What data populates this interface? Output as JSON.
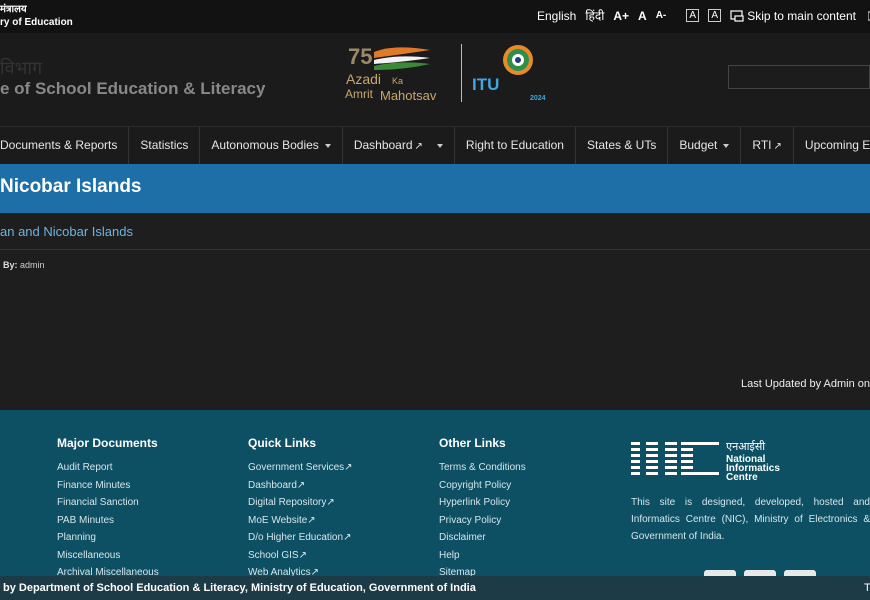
{
  "topbar": {
    "ministry_line1": "मंत्रालय",
    "ministry_line2": "ry of Education",
    "lang_english": "English",
    "lang_hindi": "हिंदी",
    "font_plus": "A+",
    "font_normal": "A",
    "font_minus": "A-",
    "contrast_a1": "A",
    "contrast_a2": "A",
    "skip": "Skip to main content"
  },
  "header": {
    "dept_line1": "विभाग",
    "dept_line2": "e of School Education & Literacy",
    "azadi_line1": "Azadi",
    "azadi_ka": "Ka",
    "azadi_line2": "Amrit",
    "azadi_line3": "Mahotsav",
    "itu": "ITU",
    "itu_year": "2024",
    "nic_hindi": "एनआईसी",
    "nic_line1": "National",
    "nic_line2": "Informatics",
    "nic_line3": "Centre"
  },
  "nav": {
    "items": [
      {
        "label": "Documents & Reports"
      },
      {
        "label": "Statistics"
      },
      {
        "label": "Autonomous Bodies"
      },
      {
        "label": "Dashboard"
      },
      {
        "label": "Right to Education"
      },
      {
        "label": "States & UTs"
      },
      {
        "label": "Budget"
      },
      {
        "label": "RTI"
      },
      {
        "label": "Upcoming Events"
      }
    ]
  },
  "page": {
    "title": "Nicobar Islands",
    "breadcrumb": "an and Nicobar Islands",
    "by_label": "By:",
    "by_value": "admin",
    "last_updated": "Last Updated by Admin on"
  },
  "footer": {
    "col1": {
      "heading": "Major Documents",
      "items": [
        "Audit Report",
        "Finance Minutes",
        "Financial Sanction",
        "PAB Minutes",
        "Planning",
        "Miscellaneous",
        "Archival Miscellaneous"
      ]
    },
    "col2": {
      "heading": "Quick Links",
      "items": [
        "Government Services",
        "Dashboard",
        "Digital Repository",
        "MoE Website",
        "D/o Higher Education",
        "School GIS",
        "Web Analytics"
      ]
    },
    "col3": {
      "heading": "Other Links",
      "items": [
        "Terms & Conditions",
        "Copyright Policy",
        "Hyperlink Policy",
        "Privacy Policy",
        "Disclaimer",
        "Help",
        "Sitemap"
      ]
    },
    "nic_description": "This site is designed, developed, hosted and Informatics Centre (NIC), Ministry of Electronics & Government of India.",
    "copyright": "by Department of School Education & Literacy, Ministry of Education, Government of India",
    "right_char": "T"
  }
}
